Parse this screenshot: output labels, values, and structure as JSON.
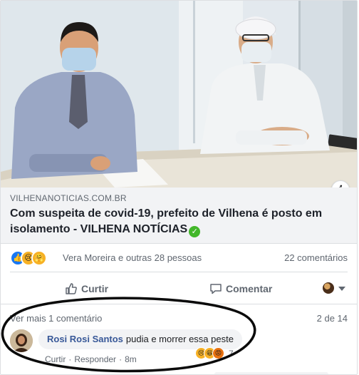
{
  "post": {
    "domain": "VILHENANOTICIAS.COM.BR",
    "headline": "Com suspeita de covid-19, prefeito de Vilhena é posto em isolamento - VILHENA NOTÍCIAS",
    "verified_icon": "check-circle-icon",
    "info_icon": "info-icon"
  },
  "reactions": {
    "icons": [
      "like-icon",
      "sad-icon",
      "care-icon"
    ],
    "names": "Vera Moreira e outras 28 pessoas",
    "comment_count": "22 comentários"
  },
  "actions": {
    "like_label": "Curtir",
    "comment_label": "Comentar"
  },
  "comments": {
    "view_more": "Ver mais 1 comentário",
    "page": "2 de 14",
    "items": [
      {
        "author": "Rosi Rosi Santos",
        "text": "pudia e morrer essa peste",
        "like": "Curtir",
        "reply": "Responder",
        "time": "8m",
        "reaction_icons": [
          "sad-icon",
          "haha-icon",
          "angry-icon"
        ],
        "reaction_count": "7"
      }
    ]
  },
  "colors": {
    "link_blue": "#385898",
    "like_blue": "#1877f2",
    "meta_gray": "#606770",
    "verified_green": "#42b72a"
  }
}
